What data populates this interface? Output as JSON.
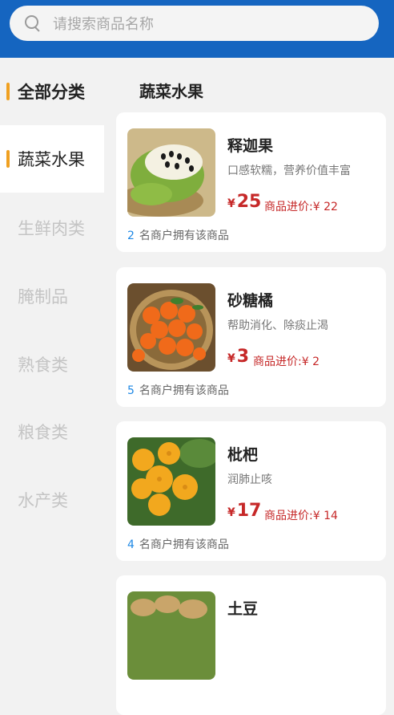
{
  "search": {
    "placeholder": "请搜索商品名称"
  },
  "sidebar": {
    "items": [
      {
        "label": "全部分类"
      },
      {
        "label": "蔬菜水果"
      },
      {
        "label": "生鲜肉类"
      },
      {
        "label": "腌制品"
      },
      {
        "label": "熟食类"
      },
      {
        "label": "粮食类"
      },
      {
        "label": "水产类"
      }
    ]
  },
  "main": {
    "section_title": "蔬菜水果",
    "products": [
      {
        "name": "释迦果",
        "desc": "口感软糯，营养价值丰富",
        "currency": "¥",
        "price": "25",
        "purchase": "商品进价:¥ 22",
        "merchant_count": "2",
        "merchant_text": "名商户拥有该商品"
      },
      {
        "name": "砂糖橘",
        "desc": "帮助消化、除痰止渴",
        "currency": "¥",
        "price": "3",
        "purchase": "商品进价:¥ 2",
        "merchant_count": "5",
        "merchant_text": "名商户拥有该商品"
      },
      {
        "name": "枇杷",
        "desc": "润肺止咳",
        "currency": "¥",
        "price": "17",
        "purchase": "商品进价:¥ 14",
        "merchant_count": "4",
        "merchant_text": "名商户拥有该商品"
      },
      {
        "name": "土豆"
      }
    ]
  },
  "colors": {
    "header": "#1565c0",
    "accent": "#f0a020",
    "price": "#c62828",
    "count": "#1e88e5"
  }
}
